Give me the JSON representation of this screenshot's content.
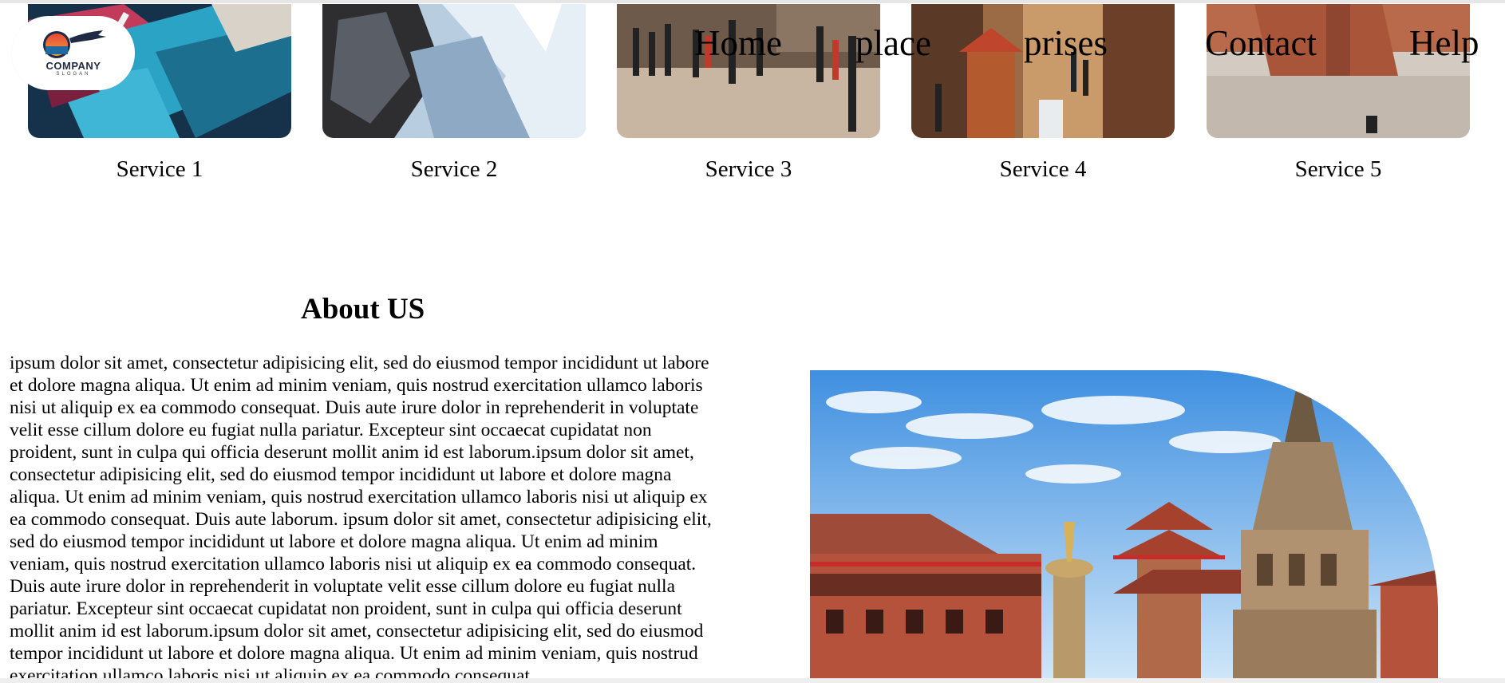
{
  "header": {
    "logo": {
      "name": "COMPANY",
      "slogan": "SLOGAN"
    },
    "nav": [
      {
        "label": "Home"
      },
      {
        "label": "place"
      },
      {
        "label": "prises"
      },
      {
        "label": "Contact"
      },
      {
        "label": "Help"
      }
    ]
  },
  "services": [
    {
      "label": "Service 1",
      "image": "boats-photo"
    },
    {
      "label": "Service 2",
      "image": "mountain-photo"
    },
    {
      "label": "Service 3",
      "image": "durbar-square-crowd-photo"
    },
    {
      "label": "Service 4",
      "image": "temple-street-photo"
    },
    {
      "label": "Service 5",
      "image": "brick-plaza-photo"
    }
  ],
  "about": {
    "title": "About US",
    "text": "ipsum dolor sit amet, consectetur adipisicing elit, sed do eiusmod tempor incididunt ut labore et dolore magna aliqua. Ut enim ad minim veniam, quis nostrud exercitation ullamco laboris nisi ut aliquip ex ea commodo consequat. Duis aute irure dolor in reprehenderit in voluptate velit esse cillum dolore eu fugiat nulla pariatur. Excepteur sint occaecat cupidatat non proident, sunt in culpa qui officia deserunt mollit anim id est laborum.ipsum dolor sit amet, consectetur adipisicing elit, sed do eiusmod tempor incididunt ut labore et dolore magna aliqua. Ut enim ad minim veniam, quis nostrud exercitation ullamco laboris nisi ut aliquip ex ea commodo consequat. Duis aute laborum. ipsum dolor sit amet, consectetur adipisicing elit, sed do eiusmod tempor incididunt ut labore et dolore magna aliqua. Ut enim ad minim veniam, quis nostrud exercitation ullamco laboris nisi ut aliquip ex ea commodo consequat. Duis aute irure dolor in reprehenderit in voluptate velit esse cillum dolore eu fugiat nulla pariatur. Excepteur sint occaecat cupidatat non proident, sunt in culpa qui officia deserunt mollit anim id est laborum.ipsum dolor sit amet, consectetur adipisicing elit, sed do eiusmod tempor incididunt ut labore et dolore magna aliqua. Ut enim ad minim veniam, quis nostrud exercitation ullamco laboris nisi ut aliquip ex ea commodo consequat.",
    "image": "bhaktapur-durbar-square-photo"
  },
  "colors": {
    "sky": "#8ec5f0",
    "brick": "#b5523b",
    "text": "#000000"
  }
}
